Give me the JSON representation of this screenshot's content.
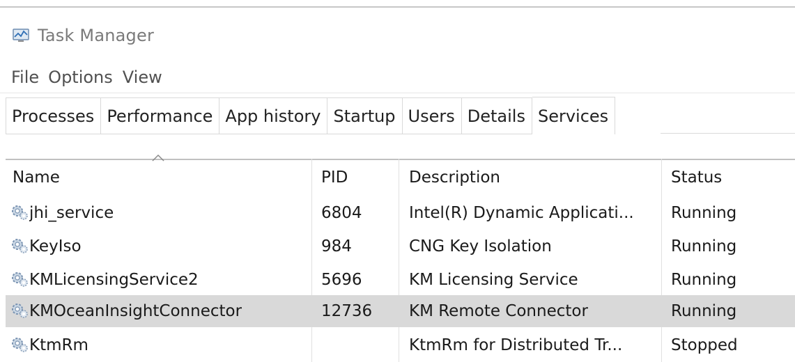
{
  "window": {
    "title": "Task Manager"
  },
  "menu": [
    "File",
    "Options",
    "View"
  ],
  "tabs": [
    "Processes",
    "Performance",
    "App history",
    "Startup",
    "Users",
    "Details",
    "Services"
  ],
  "active_tab": "Services",
  "columns": {
    "name": "Name",
    "pid": "PID",
    "description": "Description",
    "status": "Status"
  },
  "services": [
    {
      "name": "jhi_service",
      "pid": "6804",
      "description": "Intel(R) Dynamic Applicati...",
      "status": "Running"
    },
    {
      "name": "KeyIso",
      "pid": "984",
      "description": "CNG Key Isolation",
      "status": "Running"
    },
    {
      "name": "KMLicensingService2",
      "pid": "5696",
      "description": "KM Licensing Service",
      "status": "Running"
    },
    {
      "name": "KMOceanInsightConnector",
      "pid": "12736",
      "description": "KM Remote Connector",
      "status": "Running",
      "selected": true
    },
    {
      "name": "KtmRm",
      "pid": "",
      "description": "KtmRm for Distributed Tr...",
      "status": "Stopped"
    }
  ],
  "colors": {
    "selected_row": "#d9d9d9",
    "title_text": "#7a7a7a"
  },
  "icons": {
    "app": "task-manager-icon",
    "service": "gear-service-icon",
    "sort": "sort-ascending-icon"
  }
}
